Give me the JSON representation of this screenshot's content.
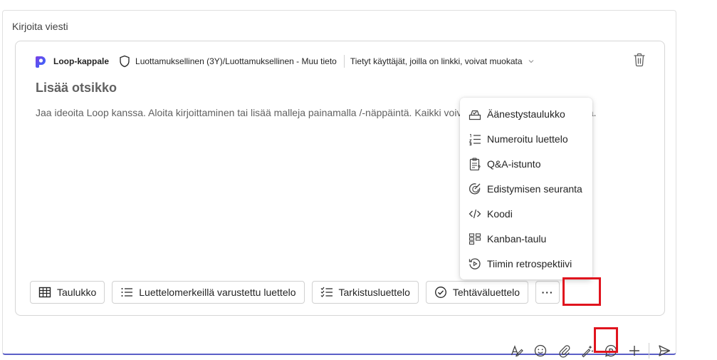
{
  "compose": {
    "label": "Kirjoita viesti"
  },
  "loop": {
    "app_name": "Loop-kappale",
    "sensitivity": "Luottamuksellinen (3Y)/Luottamuksellinen - Muu tieto",
    "share_scope": "Tietyt käyttäjät, joilla on linkki, voivat muokata",
    "title_placeholder": "Lisää otsikko",
    "body_placeholder": "Jaa ideoita Loop kanssa. Aloita kirjoittaminen tai lisää malleja painamalla /-näppäintä. Kaikki voivat muokata, mainita henkilöitä."
  },
  "chips": [
    {
      "label": "Taulukko",
      "icon": "table-icon"
    },
    {
      "label": "Luettelomerkeillä varustettu luettelo",
      "icon": "bullet-list-icon"
    },
    {
      "label": "Tarkistusluettelo",
      "icon": "checklist-icon"
    },
    {
      "label": "Tehtäväluettelo",
      "icon": "task-list-icon"
    }
  ],
  "more_label": "···",
  "menu": [
    {
      "label": "Äänestystaulukko",
      "icon": "poll-icon"
    },
    {
      "label": "Numeroitu luettelo",
      "icon": "numbered-list-icon"
    },
    {
      "label": "Q&A-istunto",
      "icon": "clipboard-question-icon"
    },
    {
      "label": "Edistymisen seuranta",
      "icon": "progress-icon"
    },
    {
      "label": "Koodi",
      "icon": "code-icon"
    },
    {
      "label": "Kanban-taulu",
      "icon": "kanban-icon"
    },
    {
      "label": "Tiimin retrospektiivi",
      "icon": "retrospective-icon"
    }
  ],
  "toolbar": [
    "format-icon",
    "emoji-icon",
    "attach-icon",
    "copilot-icon",
    "loop-icon",
    "add-icon",
    "send-icon"
  ],
  "colors": {
    "accent": "#5b5fc7",
    "highlight": "#e0141e"
  }
}
